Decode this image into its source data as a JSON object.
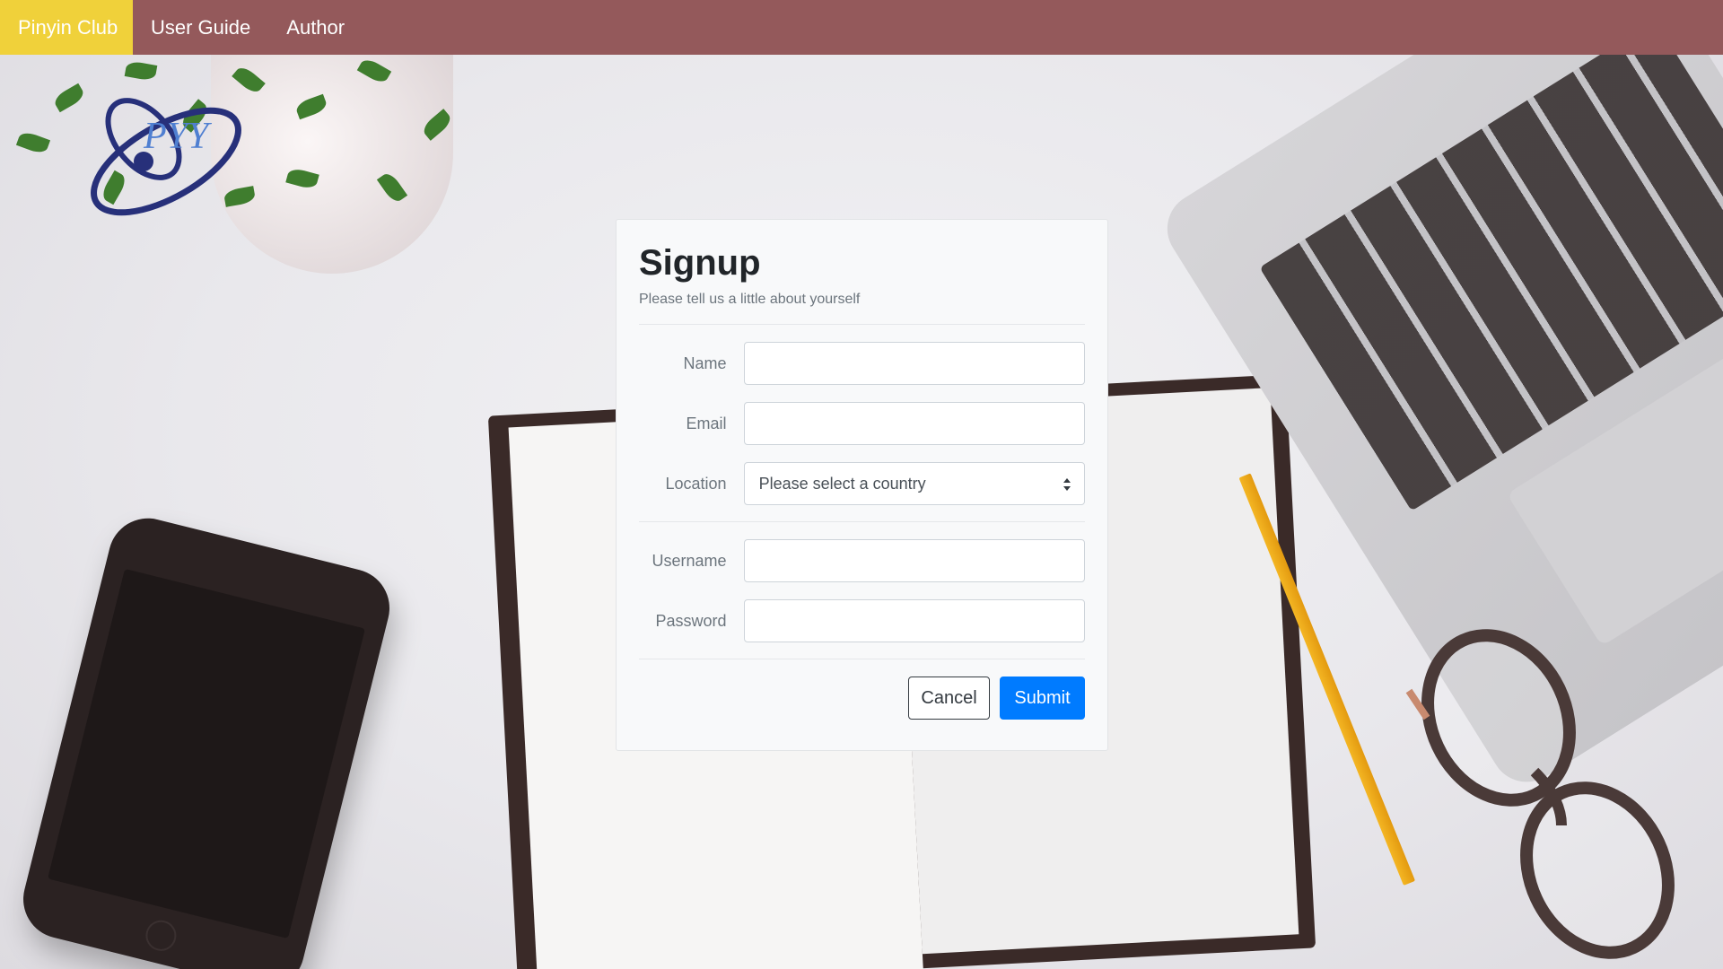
{
  "navbar": {
    "brand": "Pinyin Club",
    "links": [
      "User Guide",
      "Author"
    ]
  },
  "logo": {
    "text": "PYY"
  },
  "signup": {
    "title": "Signup",
    "subtitle": "Please tell us a little about yourself",
    "fields": {
      "name": {
        "label": "Name",
        "value": ""
      },
      "email": {
        "label": "Email",
        "value": ""
      },
      "location": {
        "label": "Location",
        "selected": "Please select a country"
      },
      "username": {
        "label": "Username",
        "value": ""
      },
      "password": {
        "label": "Password",
        "value": ""
      }
    },
    "buttons": {
      "cancel": "Cancel",
      "submit": "Submit"
    }
  },
  "colors": {
    "navbar": "#94595b",
    "brand_bg": "#f0d13a",
    "submit": "#007bff",
    "card_bg": "#f8f9fa"
  }
}
